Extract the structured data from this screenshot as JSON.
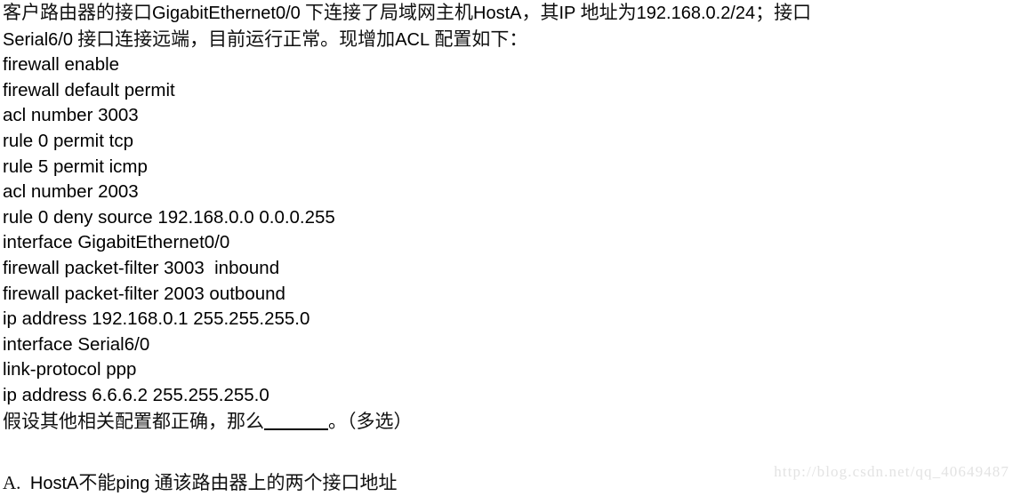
{
  "page": {
    "background_color": "#ffffff",
    "text_color": "#000000"
  },
  "question": {
    "stem_line_1_part_1": "客户路由器的接口",
    "stem_line_1_latin_1": "GigabitEthernet0/0",
    "stem_line_1_part_2": " 下连接了局域网主机",
    "stem_line_1_latin_2": "HostA",
    "stem_line_1_part_3": "，其",
    "stem_line_1_latin_3": "IP",
    "stem_line_1_part_4": " 地址为",
    "stem_line_1_latin_4": "192.168.0.2/24",
    "stem_line_1_part_5": "；接口",
    "stem_line_2_latin_1": "Serial6/0",
    "stem_line_2_part_1": " 接口连接远端，目前运行正常。现增加",
    "stem_line_2_latin_2": "ACL",
    "stem_line_2_part_2": " 配置如下："
  },
  "config": {
    "lines": [
      "firewall enable",
      "firewall default permit",
      "acl number 3003",
      "rule 0 permit tcp",
      "rule 5 permit icmp",
      "acl number 2003",
      "rule 0 deny source 192.168.0.0 0.0.0.255",
      "interface GigabitEthernet0/0",
      "firewall packet-filter 3003  inbound",
      "firewall packet-filter 2003 outbound",
      "ip address 192.168.0.1 255.255.255.0",
      "interface Serial6/0",
      "link-protocol ppp",
      "ip address 6.6.6.2 255.255.255.0"
    ]
  },
  "prompt": {
    "before_blank": "假设其他相关配置都正确，那么",
    "blank": "______",
    "after_blank": "。（多选）"
  },
  "options": [
    {
      "marker": "A.",
      "text_part_1": "  ",
      "latin_1": "HostA",
      "text_part_2": "不能",
      "latin_2": "ping",
      "text_part_3": " 通该路由器上的两个接口地址"
    }
  ],
  "watermark": {
    "text": "http://blog.csdn.net/qq_40649487",
    "color": "#e3e3e3"
  }
}
